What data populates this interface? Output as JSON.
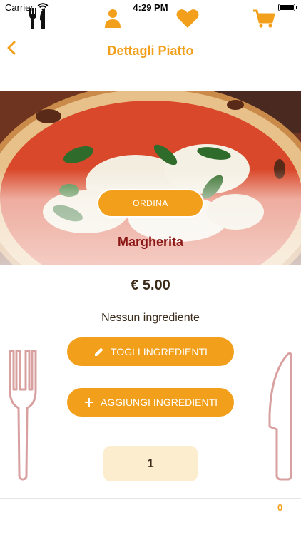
{
  "status_bar": {
    "carrier": "Carrier",
    "time": "4:29 PM",
    "battery_level": 1.0
  },
  "nav": {
    "title": "Dettagli Piatto",
    "back_icon": "chevron-left-icon"
  },
  "dish": {
    "name": "Margherita",
    "price": "€ 5.00",
    "image": "pizza-margherita-photo"
  },
  "actions": {
    "order_label": "ORDINA",
    "remove_ingredients_label": "TOGLI INGREDIENTI",
    "remove_icon": "pencil-icon",
    "add_ingredients_label": "AGGIUNGI INGREDIENTI",
    "add_icon": "plus-icon"
  },
  "ingredients": {
    "status": "Nessun ingrediente"
  },
  "quantity": {
    "value": "1"
  },
  "tab_bar": {
    "items": [
      {
        "name": "menu",
        "icon": "fork-knife-icon",
        "active": true
      },
      {
        "name": "profile",
        "icon": "user-icon",
        "active": false
      },
      {
        "name": "favorites",
        "icon": "heart-icon",
        "active": false
      },
      {
        "name": "cart",
        "icon": "cart-icon",
        "active": false
      }
    ],
    "cart_count": "0"
  },
  "colors": {
    "accent": "#f2a01c",
    "dish_name": "#8b1616",
    "quantity_bg": "#fdedcf",
    "cutlery_outline": "#d9a0a0"
  }
}
